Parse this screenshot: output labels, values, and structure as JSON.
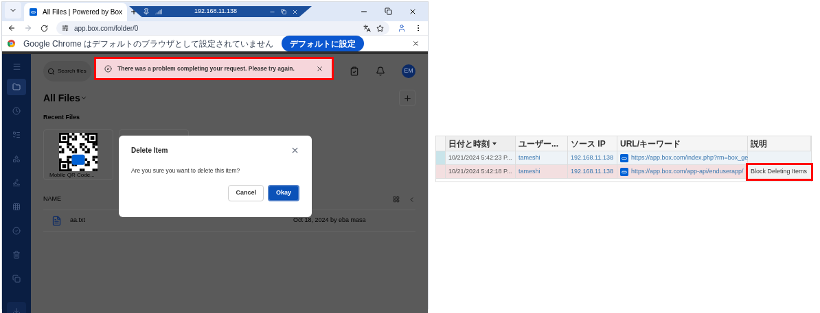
{
  "browser": {
    "tab": {
      "title": "All Files | Powered by Box"
    },
    "remote_bar": {
      "title": "192.168.11.138"
    },
    "address": "app.box.com/folder/0",
    "infobar": {
      "message": "Google Chrome はデフォルトのブラウザとして設定されていません",
      "button": "デフォルトに設定"
    }
  },
  "app": {
    "sidebar": {
      "items": [
        {
          "kind": "folder",
          "selected": true
        },
        {
          "kind": "clock",
          "selected": false
        },
        {
          "kind": "notes",
          "selected": false
        },
        {
          "kind": "apps",
          "selected": false
        },
        {
          "kind": "sign",
          "selected": false
        },
        {
          "kind": "grid",
          "selected": false
        },
        {
          "kind": "check",
          "selected": false
        },
        {
          "kind": "trash",
          "selected": false
        },
        {
          "kind": "copy",
          "selected": false
        }
      ]
    },
    "search": {
      "placeholder": "Search files"
    },
    "avatar": "EM",
    "error_banner": {
      "message": "There was a problem completing your request. Please try again.",
      "highlighted": true
    },
    "heading": "All Files",
    "recent_label": "Recent Files",
    "recent_files": [
      {
        "name": "Mobile QR Code..."
      }
    ],
    "list_header": "NAME",
    "files": [
      {
        "name": "aa.txt",
        "modified": "Oct 18, 2024 by eba masa"
      }
    ],
    "dialog": {
      "title": "Delete Item",
      "message": "Are you sure you want to delete this item?",
      "buttons": [
        {
          "label": "Cancel",
          "kind": "secondary"
        },
        {
          "label": "Okay",
          "kind": "primary"
        }
      ]
    }
  },
  "log_table": {
    "columns": [
      {
        "label": "日付と時刻",
        "sorted": true
      },
      {
        "label": "ユーザー...",
        "sorted": false
      },
      {
        "label": "ソース IP",
        "sorted": false
      },
      {
        "label": "URL/キーワード",
        "sorted": false
      },
      {
        "label": "説明",
        "sorted": false
      }
    ],
    "rows": [
      {
        "date": "10/21/2024 5:42:23 P...",
        "user": "tameshi",
        "ip": "192.168.11.138",
        "url": "https://app.box.com/index.php?rm=box_ge",
        "highlighted": false,
        "selected": true,
        "outlined": false
      },
      {
        "date": "10/21/2024 5:42:18 P...",
        "user": "tameshi",
        "ip": "192.168.11.138",
        "url": "https://app.box.com/app-api/enduserapp/",
        "description": "Block Deleting Items",
        "highlighted": true,
        "selected": false,
        "outlined": true
      }
    ]
  }
}
